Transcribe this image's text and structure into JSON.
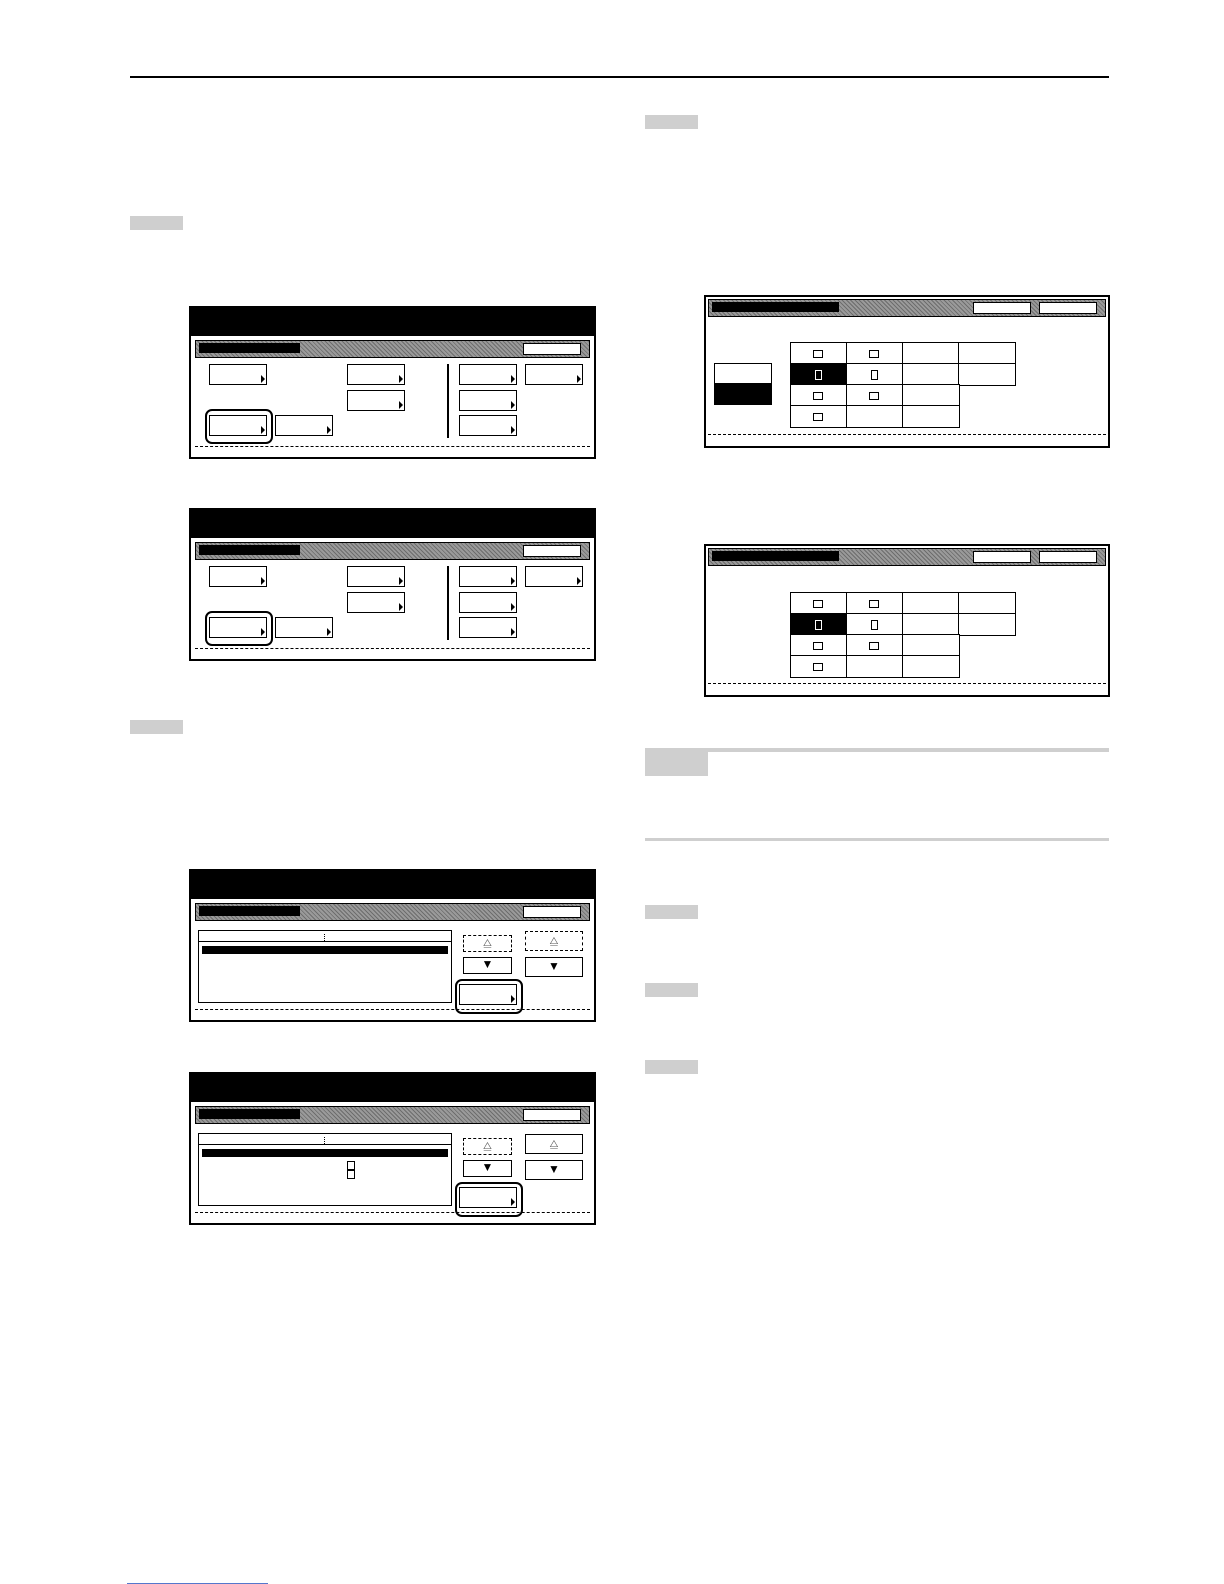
{
  "page": {
    "note_label": "",
    "body_text": []
  },
  "colors": {
    "rule": "#000000",
    "step_tab": "#cfcfcf",
    "footer_link": "#5577cc"
  },
  "icons": [
    "arrow-up-icon",
    "arrow-down-icon",
    "paper-landscape-icon",
    "paper-portrait-icon"
  ],
  "scroll_buttons": {
    "down_glyph": "▼",
    "up_glyph": "⧋"
  }
}
